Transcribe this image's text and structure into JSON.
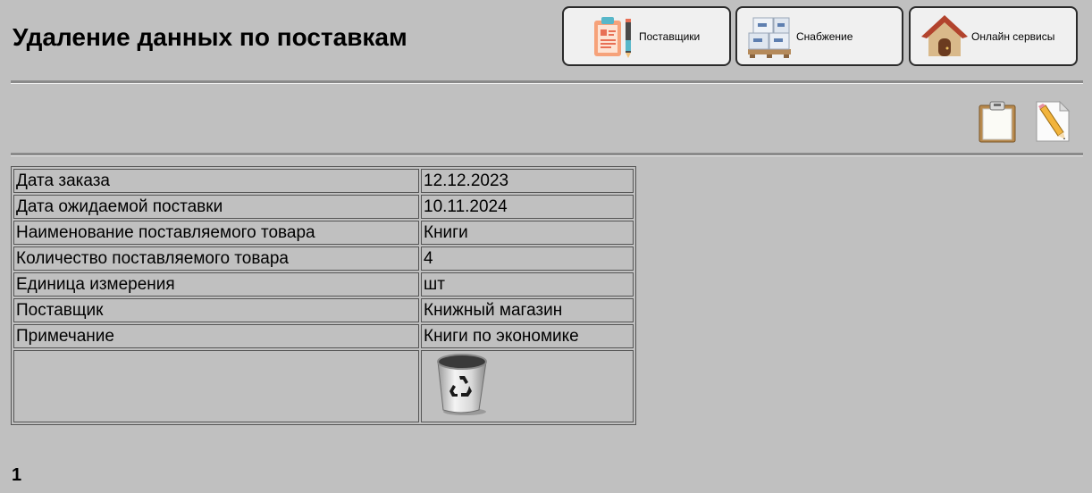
{
  "header": {
    "title": "Удаление данных по поставкам"
  },
  "nav": {
    "suppliers_label": "Поставщики",
    "supply_label": "Снабжение",
    "online_label": "Онлайн сервисы"
  },
  "record": {
    "rows": [
      {
        "label": "Дата заказа",
        "value": "12.12.2023"
      },
      {
        "label": "Дата ожидаемой поставки",
        "value": "10.11.2024"
      },
      {
        "label": "Наименование поставляемого товара",
        "value": "Книги"
      },
      {
        "label": "Количество поставляемого товара",
        "value": "4"
      },
      {
        "label": "Единица измерения",
        "value": "шт"
      },
      {
        "label": "Поставщик",
        "value": "Книжный магазин"
      },
      {
        "label": "Примечание",
        "value": "Книги по экономике"
      }
    ]
  },
  "pagination": {
    "current": "1"
  },
  "colors": {
    "background": "#c0c0c0",
    "button_bg": "#f0f0f0"
  },
  "icons": {
    "suppliers": "clipboard-list-icon",
    "supply": "boxes-pallet-icon",
    "online": "house-icon",
    "list_view": "clipboard-icon",
    "edit": "pencil-document-icon",
    "delete": "recycle-bin-icon"
  }
}
